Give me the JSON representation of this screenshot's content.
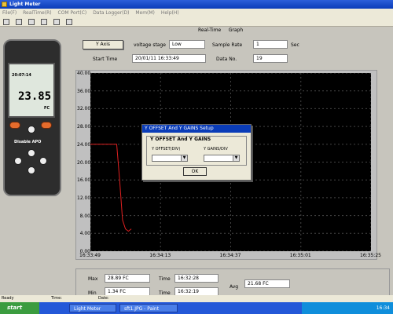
{
  "window": {
    "title": "Light Meter"
  },
  "menu": [
    "File(F)",
    "RealTime(R)",
    "COM Port(C)",
    "Data Logger(D)",
    "Mem(M)",
    "Help(H)"
  ],
  "meter_device": {
    "display_value": "23.85",
    "time": "20:07:14",
    "unit": "FC",
    "label": "Disable APO"
  },
  "header": {
    "realtime_label": "Real-Time",
    "graph_label": "Graph",
    "y_axis_button": "Y Axis",
    "voltage_stage_label": "voltage stage",
    "voltage_stage_value": "Low",
    "sample_rate_label": "Sample Rate",
    "sample_rate_value": "1",
    "sample_rate_unit": "Sec",
    "start_time_label": "Start Time",
    "start_time_value": "20/01/11 16:33:49",
    "data_no_label": "Data No.",
    "data_no_value": "19"
  },
  "chart_data": {
    "type": "line",
    "yticks": [
      "40.00",
      "36.00",
      "32.00",
      "28.00",
      "24.00",
      "20.00",
      "16.00",
      "12.00",
      "8.00",
      "4.00",
      "0.00"
    ],
    "xticks": [
      "16:33:49",
      "16:34:13",
      "16:34:37",
      "16:35:01",
      "16:35:25"
    ],
    "ylim": [
      0,
      40
    ],
    "xlim": [
      0,
      96
    ],
    "series": [
      {
        "color": "#e02020",
        "x": [
          0,
          2,
          5,
          7,
          8,
          9,
          10,
          11,
          12,
          13,
          14
        ],
        "y": [
          24,
          24,
          24,
          24,
          24,
          24,
          16,
          7,
          5,
          4.5,
          5
        ]
      }
    ]
  },
  "dialog": {
    "title": "Y OFFSET And Y GAINS Setup",
    "group_title": "Y OFFSET And Y GAINS",
    "offset_label": "Y OFFSET(DIV)",
    "gains_label": "Y GAINS/DIV",
    "ok_label": "OK"
  },
  "stats": {
    "max_label": "Max",
    "max_value": "28.89  FC",
    "min_label": "Min",
    "min_value": "1.34  FC",
    "time_label": "Time",
    "max_time": "16:32:28",
    "min_time": "16:32:19",
    "avg_label": "Avg",
    "avg_value": "21.68  FC"
  },
  "statusbar": {
    "ready": "Ready",
    "time": "Time:",
    "date": "Date:"
  },
  "taskbar": {
    "start": "start",
    "tasks": [
      "Light Meter",
      "sft1.JPG - Paint"
    ],
    "clock": "16:34"
  }
}
